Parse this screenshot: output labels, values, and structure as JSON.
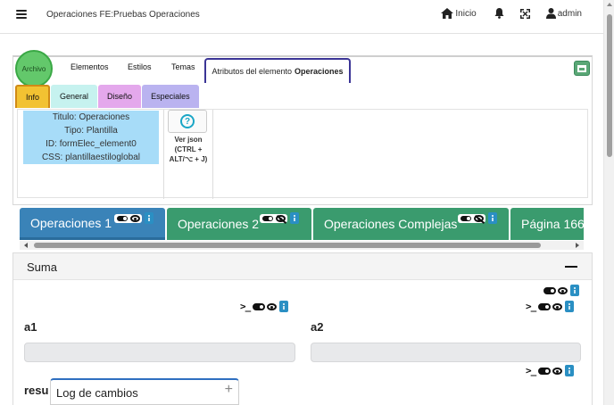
{
  "header": {
    "title": "Operaciones FE:Pruebas Operaciones",
    "home_label": "Inicio",
    "user_label": "admin"
  },
  "editor": {
    "archivo_label": "Archivo",
    "tabs": [
      {
        "label": "Elementos"
      },
      {
        "label": "Estilos"
      },
      {
        "label": "Temas"
      }
    ],
    "active_tab_prefix": "Atributos del elemento",
    "active_tab_name": "Operaciones",
    "subtabs": [
      {
        "label": "Info"
      },
      {
        "label": "General"
      },
      {
        "label": "Diseño"
      },
      {
        "label": "Especiales"
      }
    ],
    "info": {
      "titulo": "Titulo: Operaciones",
      "tipo": "Tipo: Plantilla",
      "id": "ID: formElec_element0",
      "css": "CSS: plantillaestiloglobal"
    },
    "json_button": {
      "line1": "Ver json",
      "line2": "(CTRL +",
      "line3": "ALT/⌥ + J)"
    }
  },
  "page_tabs": [
    {
      "label": "Operaciones 1",
      "color": "#3a83b8"
    },
    {
      "label": "Operaciones 2",
      "color": "#3a9b6e"
    },
    {
      "label": "Operaciones Complejas",
      "color": "#3a9b6e"
    },
    {
      "label": "Página 166",
      "color": "#3a9b6e"
    }
  ],
  "suma": {
    "title": "Suma",
    "field_a1": "a1",
    "field_a2": "a2",
    "field_resu": "resu"
  },
  "log": {
    "label": "Log de cambios",
    "plus": "+"
  },
  "colors": {
    "accent_blue": "#3a83b8",
    "accent_green": "#3a9b6e",
    "info_tab": "#f2c232",
    "general_tab": "#c6f2ef",
    "diseno_tab": "#e4a8ec",
    "especiales_tab": "#bab3f0",
    "archivo_button": "#63c86b"
  },
  "icons": [
    "menu-icon",
    "home-icon",
    "bell-icon",
    "fullscreen-icon",
    "user-icon",
    "save-icon",
    "help-icon",
    "toggle-icon",
    "eye-icon",
    "eye-slash-icon",
    "kebab-icon",
    "terminal-icon",
    "minus-icon",
    "plus-icon"
  ]
}
